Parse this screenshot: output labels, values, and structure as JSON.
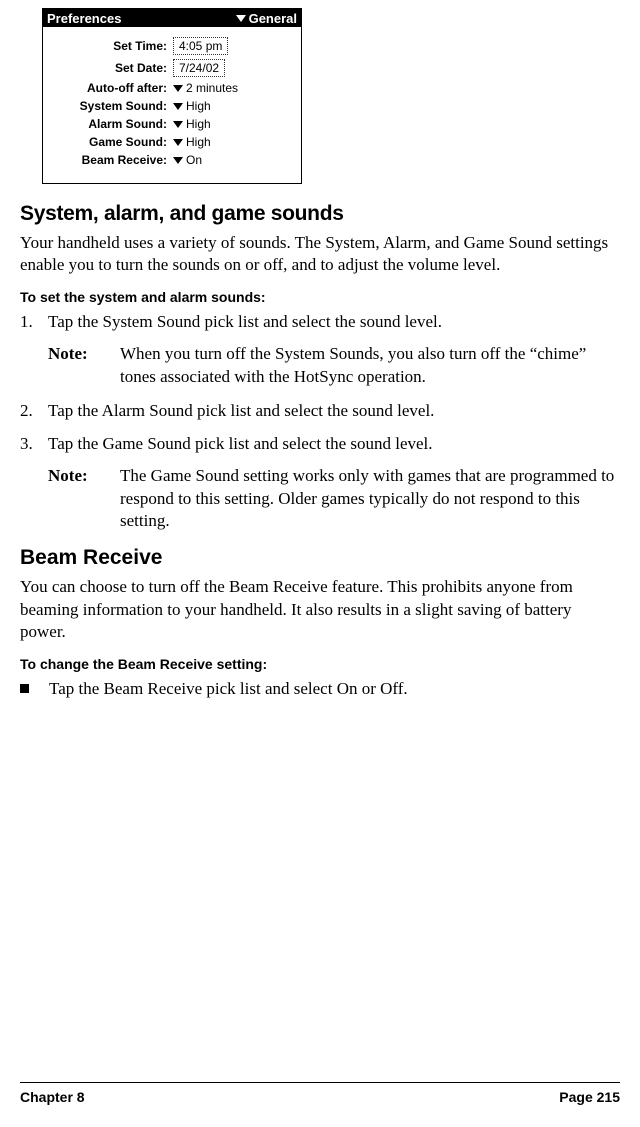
{
  "palm": {
    "title": "Preferences",
    "category": "General",
    "rows": [
      {
        "label": "Set Time:",
        "value": "4:05 pm",
        "boxed": true,
        "arrow": false
      },
      {
        "label": "Set Date:",
        "value": "7/24/02",
        "boxed": true,
        "arrow": false
      },
      {
        "label": "Auto-off after:",
        "value": "2 minutes",
        "boxed": false,
        "arrow": true
      },
      {
        "label": "System Sound:",
        "value": "High",
        "boxed": false,
        "arrow": true
      },
      {
        "label": "Alarm Sound:",
        "value": "High",
        "boxed": false,
        "arrow": true
      },
      {
        "label": "Game Sound:",
        "value": "High",
        "boxed": false,
        "arrow": true
      },
      {
        "label": "Beam Receive:",
        "value": "On",
        "boxed": false,
        "arrow": true
      }
    ]
  },
  "sounds": {
    "heading": "System, alarm, and game sounds",
    "intro": "Your handheld uses a variety of sounds. The System, Alarm, and Game Sound settings enable you to turn the sounds on or off, and to adjust the volume level.",
    "proc_heading": "To set the system and alarm sounds:",
    "step1": "Tap the System Sound pick list and select the sound level.",
    "note1": "When you turn off the System Sounds, you also turn off the “chime” tones associated with the HotSync operation.",
    "step2": "Tap the Alarm Sound pick list and select the sound level.",
    "step3": "Tap the Game Sound pick list and select the sound level.",
    "note2": "The Game Sound setting works only with games that are programmed to respond to this setting. Older games typically do not respond to this setting.",
    "note_label": "Note:"
  },
  "beam": {
    "heading": "Beam Receive",
    "intro": "You can choose to turn off the Beam Receive feature. This prohibits anyone from beaming information to your handheld. It also results in a slight saving of battery power.",
    "proc_heading": "To change the Beam Receive setting:",
    "bullet": "Tap the Beam Receive pick list and select On or Off."
  },
  "footer": {
    "left": "Chapter 8",
    "right": "Page 215"
  }
}
